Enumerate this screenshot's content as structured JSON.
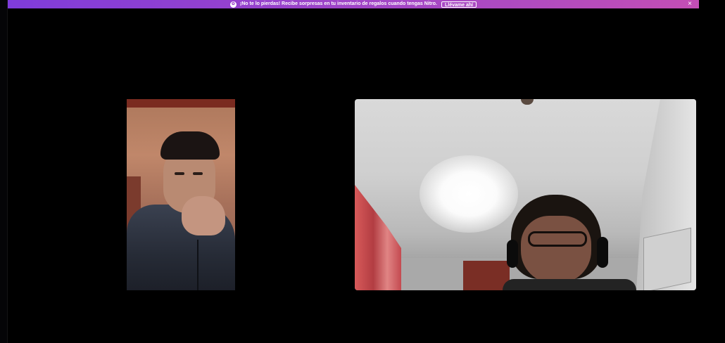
{
  "banner": {
    "icon": "nitro-icon",
    "text": "¡No te lo pierdas! Recibe sorpresas en tu inventario de regalos cuando tengas Nitro.",
    "cta_label": "Llévame ahí",
    "close_label": "×",
    "colors": {
      "gradient_start": "#7f3cdb",
      "gradient_end": "#c44eb5"
    }
  },
  "call": {
    "background": "#000000",
    "participants": [
      {
        "tile": "camera-feed-participant-1"
      },
      {
        "tile": "camera-feed-participant-2"
      }
    ]
  }
}
